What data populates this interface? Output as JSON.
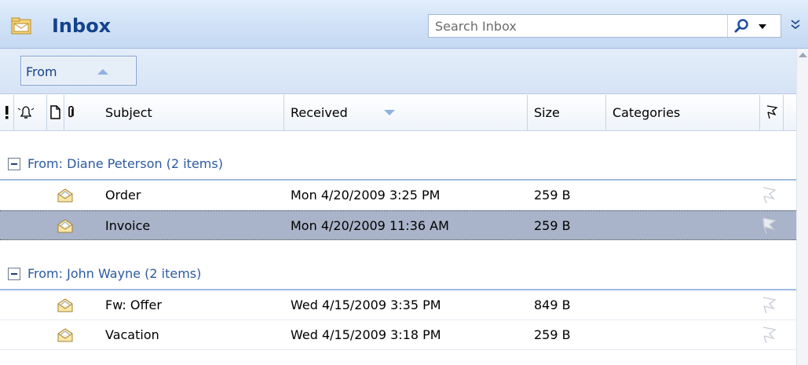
{
  "header": {
    "title": "Inbox",
    "search_placeholder": "Search Inbox"
  },
  "arrange": {
    "by_label": "From"
  },
  "columns": {
    "subject": "Subject",
    "received": "Received",
    "size": "Size",
    "categories": "Categories"
  },
  "groups": [
    {
      "label": "From: Diane Peterson (2 items)",
      "rows": [
        {
          "subject": "Order",
          "received": "Mon 4/20/2009 3:25 PM",
          "size": "259 B",
          "selected": false
        },
        {
          "subject": "Invoice",
          "received": "Mon 4/20/2009 11:36 AM",
          "size": "259 B",
          "selected": true
        }
      ]
    },
    {
      "label": "From: John Wayne (2 items)",
      "rows": [
        {
          "subject": "Fw: Offer",
          "received": "Wed 4/15/2009 3:35 PM",
          "size": "849 B",
          "selected": false
        },
        {
          "subject": "Vacation",
          "received": "Wed 4/15/2009 3:18 PM",
          "size": "259 B",
          "selected": false
        }
      ]
    }
  ],
  "icons": {
    "header": [
      "importance-icon",
      "reminder-icon",
      "item-type-icon",
      "attachment-icon",
      "flag-status-icon"
    ],
    "row": [
      "read-envelope-icon",
      "flag-icon"
    ]
  },
  "colors": {
    "title": "#15428b",
    "group_label": "#2c5aa0",
    "selected_row": "#a9b3c9"
  }
}
